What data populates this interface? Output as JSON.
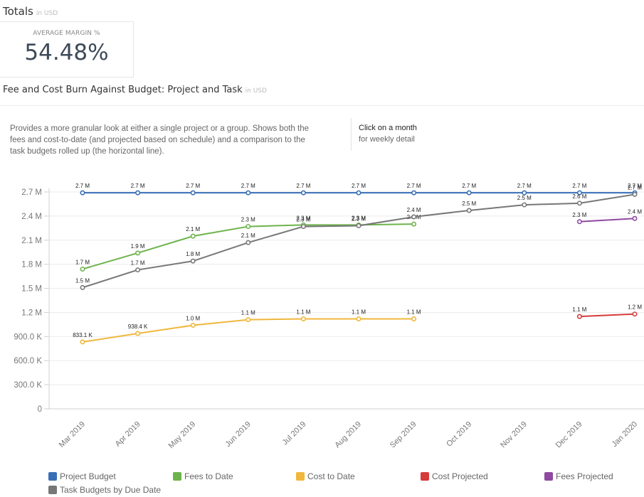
{
  "totals": {
    "title": "Totals",
    "unit": "in USD",
    "kpi": {
      "label": "AVERAGE MARGIN %",
      "value": "54.48%"
    }
  },
  "section": {
    "title": "Fee and Cost Burn Against Budget: Project and Task",
    "unit": "in USD",
    "description": "Provides a more granular look at either a single project or a group.  Shows both the fees and cost-to-date (and projected based on schedule) and a comparison to the task budgets rolled up (the horizontal line).",
    "hint_title": "Click on a month",
    "hint_sub": "for weekly detail"
  },
  "chart_data": {
    "type": "line",
    "title": "",
    "xlabel": "",
    "ylabel": "",
    "categories": [
      "Mar 2019",
      "Apr 2019",
      "May 2019",
      "Jun 2019",
      "Jul 2019",
      "Aug 2019",
      "Sep 2019",
      "Oct 2019",
      "Nov 2019",
      "Dec 2019",
      "Jan 2020"
    ],
    "ylim": [
      0,
      2700000
    ],
    "yticks": [
      0,
      300000,
      600000,
      900000,
      1200000,
      1500000,
      1800000,
      2100000,
      2400000,
      2700000
    ],
    "ytick_labels": [
      "0",
      "300.0 K",
      "600.0 K",
      "900.0 K",
      "1.2 M",
      "1.5 M",
      "1.8 M",
      "2.1 M",
      "2.4 M",
      "2.7 M"
    ],
    "grid": true,
    "legend_position": "bottom",
    "series": [
      {
        "name": "Project Budget",
        "color": "#3a6fb7",
        "values": [
          2690000,
          2690000,
          2690000,
          2690000,
          2690000,
          2690000,
          2690000,
          2690000,
          2690000,
          2690000,
          2690000
        ],
        "labels": [
          "2.7 M",
          "2.7 M",
          "2.7 M",
          "2.7 M",
          "2.7 M",
          "2.7 M",
          "2.7 M",
          "2.7 M",
          "2.7 M",
          "2.7 M",
          "2.7 M"
        ]
      },
      {
        "name": "Fees to Date",
        "color": "#6db34b",
        "values": [
          1740000,
          1940000,
          2150000,
          2270000,
          2290000,
          2290000,
          2300000,
          null,
          null,
          null,
          null
        ],
        "labels": [
          "1.7 M",
          "1.9 M",
          "2.1 M",
          "2.3 M",
          "2.3 M",
          "2.3 M",
          "2.3 M",
          null,
          null,
          null,
          null
        ]
      },
      {
        "name": "Cost to Date",
        "color": "#f0b73c",
        "values": [
          833100,
          938400,
          1040000,
          1110000,
          1120000,
          1120000,
          1120000,
          null,
          null,
          null,
          null
        ],
        "labels": [
          "833.1 K",
          "938.4 K",
          "1.0 M",
          "1.1 M",
          "1.1 M",
          "1.1 M",
          "1.1 M",
          null,
          null,
          null,
          null
        ]
      },
      {
        "name": "Cost Projected",
        "color": "#d63b3b",
        "values": [
          null,
          null,
          null,
          null,
          null,
          null,
          null,
          null,
          null,
          1150000,
          1180000
        ],
        "labels": [
          null,
          null,
          null,
          null,
          null,
          null,
          null,
          null,
          null,
          "1.1 M",
          "1.2 M"
        ]
      },
      {
        "name": "Fees Projected",
        "color": "#8e4aa0",
        "values": [
          null,
          null,
          null,
          null,
          null,
          null,
          null,
          null,
          null,
          2330000,
          2370000
        ],
        "labels": [
          null,
          null,
          null,
          null,
          null,
          null,
          null,
          null,
          null,
          "2.3 M",
          "2.4 M"
        ]
      },
      {
        "name": "Task Budgets by Due Date",
        "color": "#777777",
        "values": [
          1510000,
          1730000,
          1840000,
          2070000,
          2270000,
          2280000,
          2390000,
          2470000,
          2540000,
          2560000,
          2670000
        ],
        "labels": [
          "1.5 M",
          "1.7 M",
          "1.8 M",
          "2.1 M",
          "2.3 M",
          "2.3 M",
          "2.4 M",
          "2.5 M",
          "2.5 M",
          "2.6 M",
          "2.7 M"
        ]
      }
    ]
  }
}
